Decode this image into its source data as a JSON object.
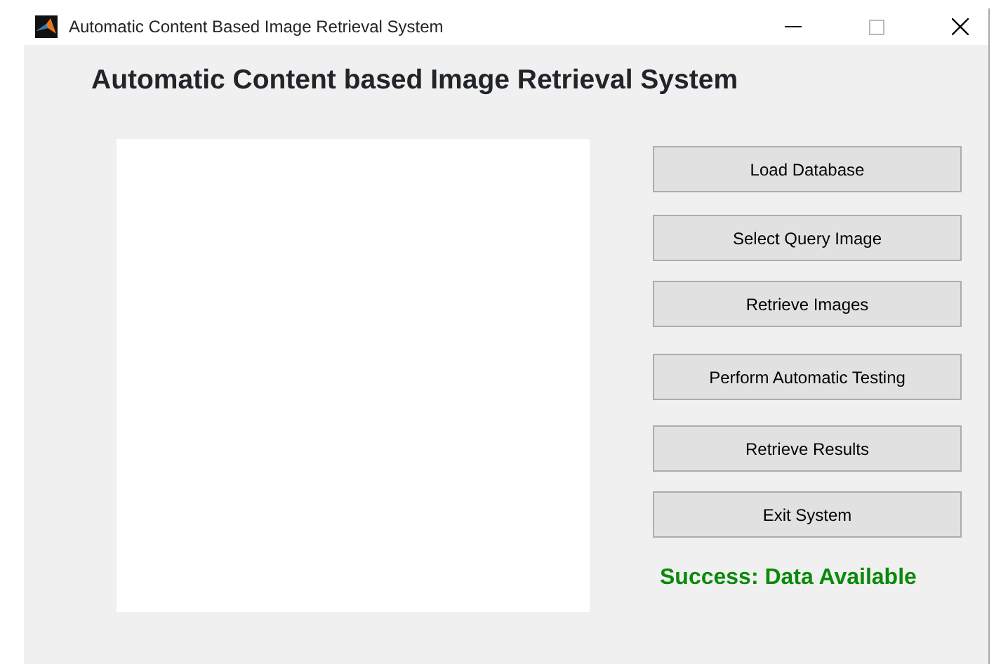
{
  "window": {
    "title": "Automatic Content Based Image Retrieval System"
  },
  "heading": "Automatic Content based Image Retrieval System",
  "buttons": [
    "Load Database",
    "Select Query Image",
    "Retrieve Images",
    "Perform Automatic Testing",
    "Retrieve Results",
    "Exit System"
  ],
  "status": {
    "text": "Success: Data Available",
    "kind": "success"
  }
}
